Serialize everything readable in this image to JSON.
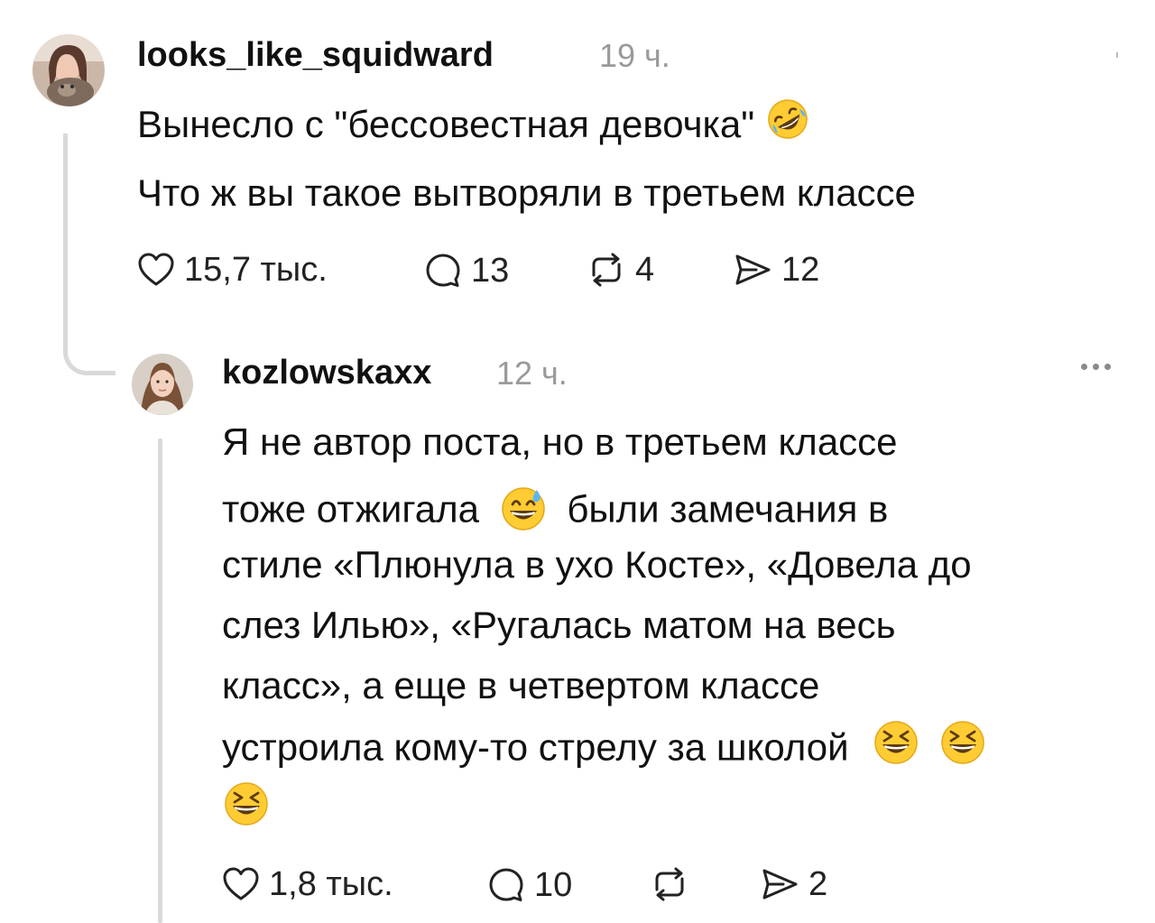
{
  "post": {
    "username": "looks_like_squidward",
    "time": "19 ч.",
    "lines": [
      "Вынесло с \"бессовестная девочка\"",
      "Что ж вы такое вытворяли в третьем классе"
    ],
    "emoji_icon": "rolling-on-floor-laughing-icon",
    "actions": {
      "likes": "15,7 тыс.",
      "comments": "13",
      "reposts": "4",
      "shares": "12"
    }
  },
  "reply": {
    "username": "kozlowskaxx",
    "time": "12 ч.",
    "lines": [
      "Я не автор поста, но в третьем классе",
      "тоже отжигала",
      "были замечания в",
      "стиле «Плюнула в ухо Косте», «Довела до",
      "слез Илью», «Ругалась матом на весь",
      "класс», а еще в четвертом классе",
      "устроила кому-то стрелу за школой"
    ],
    "emoji_icons": [
      "grinning-sweat-icon",
      "laughing-squinting-icon"
    ],
    "actions": {
      "likes": "1,8 тыс.",
      "comments": "10",
      "reposts": "",
      "shares": "2"
    }
  },
  "colors": {
    "text": "#111111",
    "muted": "#9a9a9a",
    "thread": "#d9d9d9",
    "emoji_yellow": "#ffcc33"
  }
}
